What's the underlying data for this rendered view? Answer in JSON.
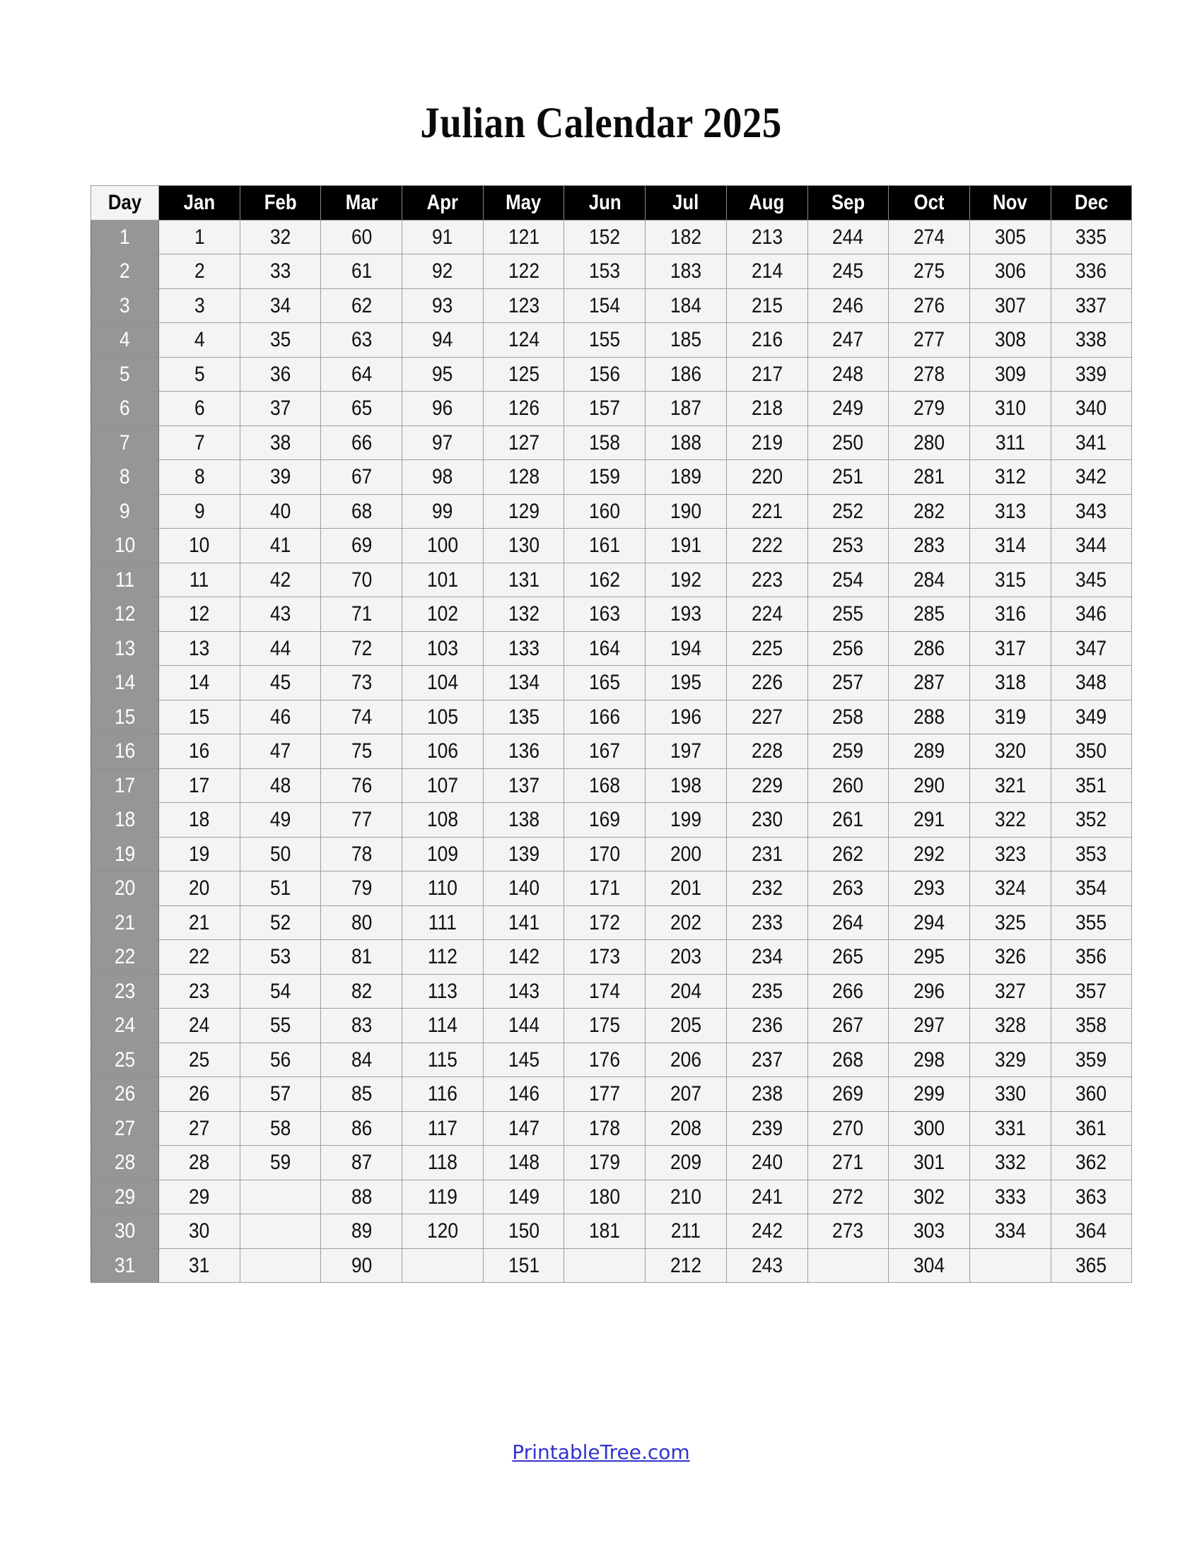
{
  "document": {
    "title": "Julian Calendar 2025",
    "year": "2025"
  },
  "table": {
    "day_header": "Day",
    "month_headers": [
      "Jan",
      "Feb",
      "Mar",
      "Apr",
      "May",
      "Jun",
      "Jul",
      "Aug",
      "Sep",
      "Oct",
      "Nov",
      "Dec"
    ],
    "day_labels": [
      "1",
      "2",
      "3",
      "4",
      "5",
      "6",
      "7",
      "8",
      "9",
      "10",
      "11",
      "12",
      "13",
      "14",
      "15",
      "16",
      "17",
      "18",
      "19",
      "20",
      "21",
      "22",
      "23",
      "24",
      "25",
      "26",
      "27",
      "28",
      "29",
      "30",
      "31"
    ],
    "rows": [
      [
        "1",
        "1",
        "32",
        "60",
        "91",
        "121",
        "152",
        "182",
        "213",
        "244",
        "274",
        "305",
        "335"
      ],
      [
        "2",
        "2",
        "33",
        "61",
        "92",
        "122",
        "153",
        "183",
        "214",
        "245",
        "275",
        "306",
        "336"
      ],
      [
        "3",
        "3",
        "34",
        "62",
        "93",
        "123",
        "154",
        "184",
        "215",
        "246",
        "276",
        "307",
        "337"
      ],
      [
        "4",
        "4",
        "35",
        "63",
        "94",
        "124",
        "155",
        "185",
        "216",
        "247",
        "277",
        "308",
        "338"
      ],
      [
        "5",
        "5",
        "36",
        "64",
        "95",
        "125",
        "156",
        "186",
        "217",
        "248",
        "278",
        "309",
        "339"
      ],
      [
        "6",
        "6",
        "37",
        "65",
        "96",
        "126",
        "157",
        "187",
        "218",
        "249",
        "279",
        "310",
        "340"
      ],
      [
        "7",
        "7",
        "38",
        "66",
        "97",
        "127",
        "158",
        "188",
        "219",
        "250",
        "280",
        "311",
        "341"
      ],
      [
        "8",
        "8",
        "39",
        "67",
        "98",
        "128",
        "159",
        "189",
        "220",
        "251",
        "281",
        "312",
        "342"
      ],
      [
        "9",
        "9",
        "40",
        "68",
        "99",
        "129",
        "160",
        "190",
        "221",
        "252",
        "282",
        "313",
        "343"
      ],
      [
        "10",
        "10",
        "41",
        "69",
        "100",
        "130",
        "161",
        "191",
        "222",
        "253",
        "283",
        "314",
        "344"
      ],
      [
        "11",
        "11",
        "42",
        "70",
        "101",
        "131",
        "162",
        "192",
        "223",
        "254",
        "284",
        "315",
        "345"
      ],
      [
        "12",
        "12",
        "43",
        "71",
        "102",
        "132",
        "163",
        "193",
        "224",
        "255",
        "285",
        "316",
        "346"
      ],
      [
        "13",
        "13",
        "44",
        "72",
        "103",
        "133",
        "164",
        "194",
        "225",
        "256",
        "286",
        "317",
        "347"
      ],
      [
        "14",
        "14",
        "45",
        "73",
        "104",
        "134",
        "165",
        "195",
        "226",
        "257",
        "287",
        "318",
        "348"
      ],
      [
        "15",
        "15",
        "46",
        "74",
        "105",
        "135",
        "166",
        "196",
        "227",
        "258",
        "288",
        "319",
        "349"
      ],
      [
        "16",
        "16",
        "47",
        "75",
        "106",
        "136",
        "167",
        "197",
        "228",
        "259",
        "289",
        "320",
        "350"
      ],
      [
        "17",
        "17",
        "48",
        "76",
        "107",
        "137",
        "168",
        "198",
        "229",
        "260",
        "290",
        "321",
        "351"
      ],
      [
        "18",
        "18",
        "49",
        "77",
        "108",
        "138",
        "169",
        "199",
        "230",
        "261",
        "291",
        "322",
        "352"
      ],
      [
        "19",
        "19",
        "50",
        "78",
        "109",
        "139",
        "170",
        "200",
        "231",
        "262",
        "292",
        "323",
        "353"
      ],
      [
        "20",
        "20",
        "51",
        "79",
        "110",
        "140",
        "171",
        "201",
        "232",
        "263",
        "293",
        "324",
        "354"
      ],
      [
        "21",
        "21",
        "52",
        "80",
        "111",
        "141",
        "172",
        "202",
        "233",
        "264",
        "294",
        "325",
        "355"
      ],
      [
        "22",
        "22",
        "53",
        "81",
        "112",
        "142",
        "173",
        "203",
        "234",
        "265",
        "295",
        "326",
        "356"
      ],
      [
        "23",
        "23",
        "54",
        "82",
        "113",
        "143",
        "174",
        "204",
        "235",
        "266",
        "296",
        "327",
        "357"
      ],
      [
        "24",
        "24",
        "55",
        "83",
        "114",
        "144",
        "175",
        "205",
        "236",
        "267",
        "297",
        "328",
        "358"
      ],
      [
        "25",
        "25",
        "56",
        "84",
        "115",
        "145",
        "176",
        "206",
        "237",
        "268",
        "298",
        "329",
        "359"
      ],
      [
        "26",
        "26",
        "57",
        "85",
        "116",
        "146",
        "177",
        "207",
        "238",
        "269",
        "299",
        "330",
        "360"
      ],
      [
        "27",
        "27",
        "58",
        "86",
        "117",
        "147",
        "178",
        "208",
        "239",
        "270",
        "300",
        "331",
        "361"
      ],
      [
        "28",
        "28",
        "59",
        "87",
        "118",
        "148",
        "179",
        "209",
        "240",
        "271",
        "301",
        "332",
        "362"
      ],
      [
        "29",
        "29",
        "",
        "88",
        "119",
        "149",
        "180",
        "210",
        "241",
        "272",
        "302",
        "333",
        "363"
      ],
      [
        "30",
        "30",
        "",
        "89",
        "120",
        "150",
        "181",
        "211",
        "242",
        "273",
        "303",
        "334",
        "364"
      ],
      [
        "31",
        "31",
        "",
        "90",
        "",
        "151",
        "",
        "212",
        "243",
        "",
        "304",
        "",
        "365"
      ]
    ]
  },
  "footer": {
    "link_text": "PrintableTree.com"
  },
  "colors": {
    "header_bg": "#000000",
    "header_text": "#ffffff",
    "day_header_bg": "#f4f4f4",
    "day_col_bg": "#969696",
    "day_col_text": "#ffffff",
    "cell_bg": "#f4f4f4",
    "cell_text": "#111111",
    "border": "#9e9e9e",
    "link": "#3333cc",
    "title_text": "#0a0a0a"
  }
}
